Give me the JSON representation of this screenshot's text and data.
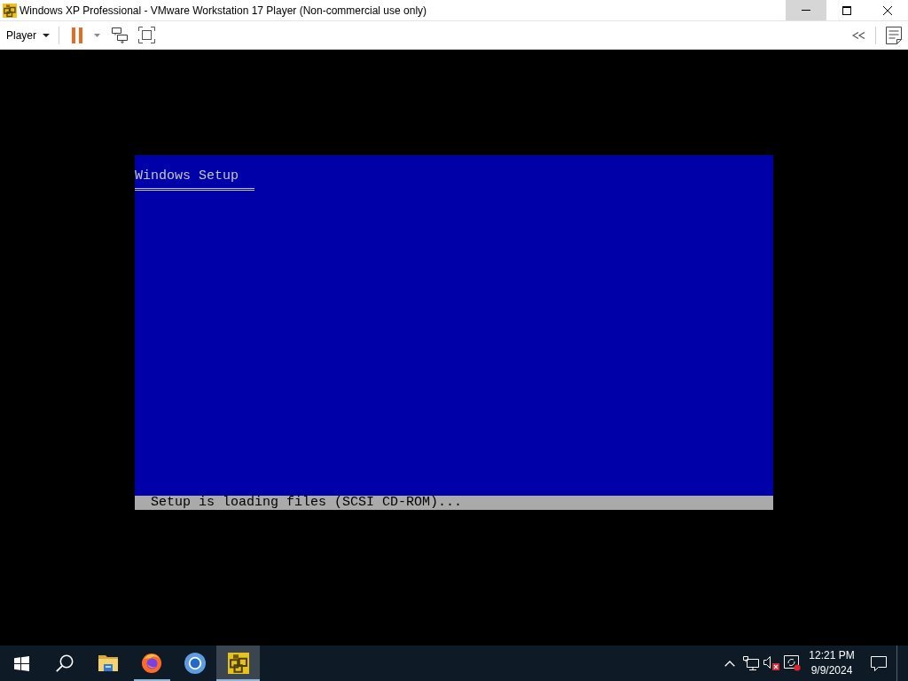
{
  "window": {
    "title": "Windows XP Professional - VMware Workstation 17 Player (Non-commercial use only)",
    "controls": [
      {
        "kind": "minimize",
        "hovered": true
      },
      {
        "kind": "maximize",
        "hovered": false
      },
      {
        "kind": "close",
        "hovered": false
      }
    ]
  },
  "toolbar": {
    "menu": "Player"
  },
  "vm_screen": {
    "title": "Windows Setup",
    "status": "Setup is loading files (SCSI CD-ROM)..."
  },
  "taskbar": {
    "apps": [
      {
        "kind": "folder",
        "running": false,
        "selected": false
      },
      {
        "kind": "fox_browser",
        "running": true,
        "selected": false
      },
      {
        "kind": "ring_browser",
        "running": false,
        "selected": false
      },
      {
        "kind": "vm_player",
        "running": true,
        "selected": true
      }
    ],
    "clock": {
      "time": "12:21 PM",
      "date": "9/9/2024"
    }
  }
}
